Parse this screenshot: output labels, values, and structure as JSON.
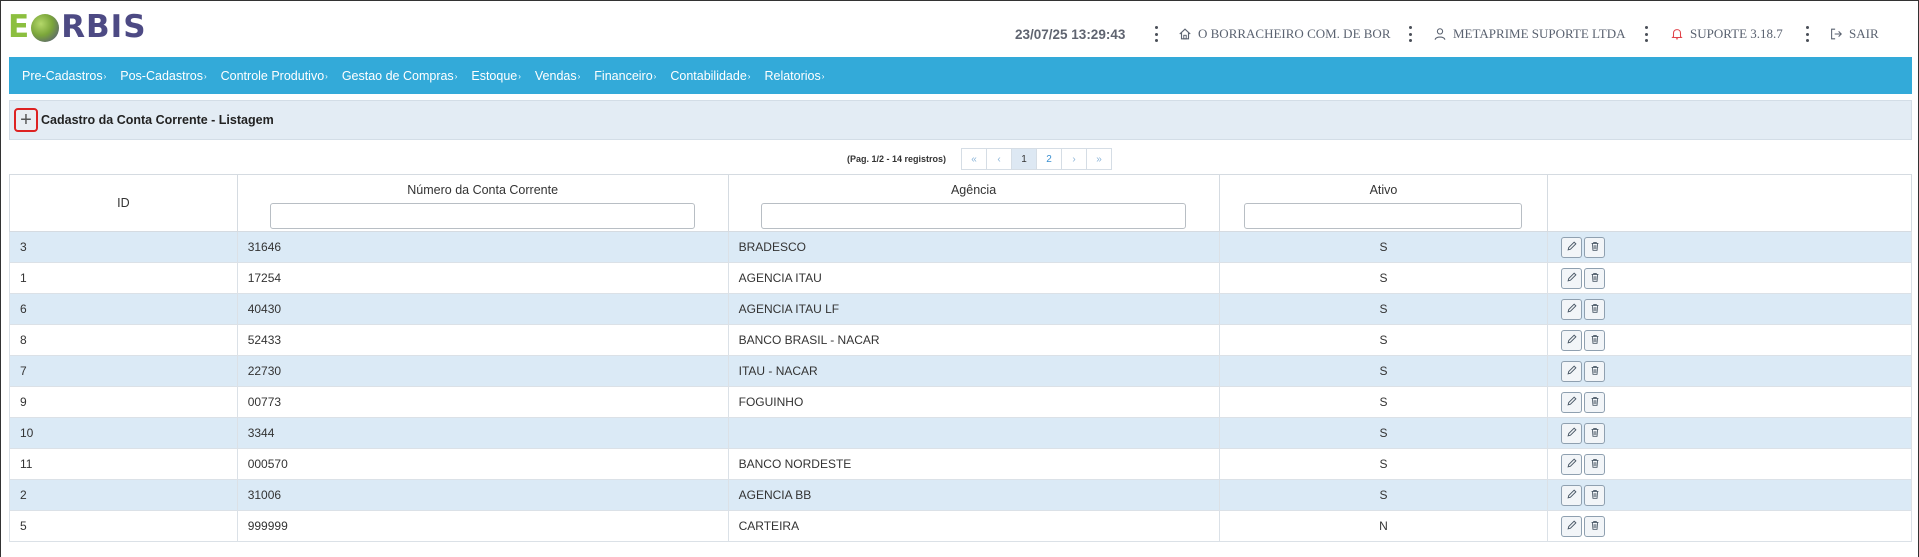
{
  "header": {
    "logo": {
      "e": "E",
      "rbis": "RBIS"
    },
    "datetime": "23/07/25 13:29:43",
    "company": "O BORRACHEIRO COM. DE BOR",
    "user": "METAPRIME SUPORTE LTDA",
    "version": "SUPORTE 3.18.7",
    "logout": "SAIR",
    "icons": [
      "home-icon",
      "user-icon",
      "bell-icon",
      "logout-icon"
    ]
  },
  "nav": {
    "items": [
      {
        "label": "Pre-Cadastros"
      },
      {
        "label": "Pos-Cadastros"
      },
      {
        "label": "Controle Produtivo"
      },
      {
        "label": "Gestao de Compras"
      },
      {
        "label": "Estoque"
      },
      {
        "label": "Vendas"
      },
      {
        "label": "Financeiro"
      },
      {
        "label": "Contabilidade"
      },
      {
        "label": "Relatorios"
      }
    ],
    "caret": "›"
  },
  "page": {
    "add_symbol": "+",
    "title": "Cadastro da Conta Corrente - Listagem"
  },
  "pagination": {
    "info": "(Pag. 1/2 - 14 registros)",
    "first": "«",
    "prev": "‹",
    "pages": [
      "1",
      "2"
    ],
    "active_page": "1",
    "next": "›",
    "last": "»"
  },
  "table": {
    "columns": [
      "ID",
      "Número da Conta Corrente",
      "Agência",
      "Ativo"
    ],
    "filters": {
      "numero": "",
      "agencia": "",
      "ativo": ""
    },
    "rows": [
      {
        "id": "3",
        "numero": "31646",
        "agencia": "BRADESCO",
        "ativo": "S"
      },
      {
        "id": "1",
        "numero": "17254",
        "agencia": "AGENCIA ITAU",
        "ativo": "S"
      },
      {
        "id": "6",
        "numero": "40430",
        "agencia": "AGENCIA ITAU LF",
        "ativo": "S"
      },
      {
        "id": "8",
        "numero": "52433",
        "agencia": "BANCO BRASIL - NACAR",
        "ativo": "S"
      },
      {
        "id": "7",
        "numero": "22730",
        "agencia": "ITAU - NACAR",
        "ativo": "S"
      },
      {
        "id": "9",
        "numero": "00773",
        "agencia": "FOGUINHO",
        "ativo": "S"
      },
      {
        "id": "10",
        "numero": "3344",
        "agencia": "",
        "ativo": "S"
      },
      {
        "id": "11",
        "numero": "000570",
        "agencia": "BANCO NORDESTE",
        "ativo": "S"
      },
      {
        "id": "2",
        "numero": "31006",
        "agencia": "AGENCIA BB",
        "ativo": "S"
      },
      {
        "id": "5",
        "numero": "999999",
        "agencia": "CARTEIRA",
        "ativo": "N"
      }
    ]
  },
  "colors": {
    "nav_bg": "#33aad9",
    "row_striped": "#dbeaf6",
    "titlebar_bg": "#e3ecf4",
    "add_border": "#dd2222",
    "logo_green": "#8cbf3f",
    "logo_purple": "#4d4a84",
    "bell": "#e0434a"
  }
}
